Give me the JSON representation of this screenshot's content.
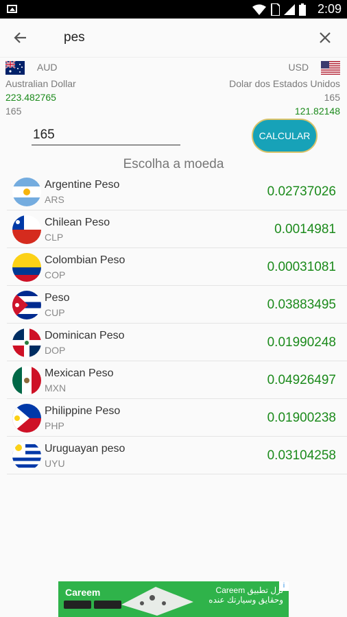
{
  "status": {
    "time": "2:09"
  },
  "search": {
    "query": "pes"
  },
  "conversion": {
    "from": {
      "code": "AUD",
      "name": "Australian Dollar",
      "rate": "223.482765",
      "amount": "165"
    },
    "to": {
      "code": "USD",
      "name": "Dolar dos Estados Unidos",
      "amount": "165",
      "result": "121.82148"
    }
  },
  "input": {
    "value": "165"
  },
  "calc_button": "CALCULAR",
  "choose_label": "Escolha a moeda",
  "currencies": [
    {
      "name": "Argentine Peso",
      "code": "ARS",
      "value": "0.02737026",
      "flag": "argentina-flag"
    },
    {
      "name": "Chilean Peso",
      "code": "CLP",
      "value": "0.0014981",
      "flag": "chile-flag"
    },
    {
      "name": "Colombian Peso",
      "code": "COP",
      "value": "0.00031081",
      "flag": "colombia-flag"
    },
    {
      "name": "Peso",
      "code": "CUP",
      "value": "0.03883495",
      "flag": "cuba-flag"
    },
    {
      "name": "Dominican Peso",
      "code": "DOP",
      "value": "0.01990248",
      "flag": "dominican-flag"
    },
    {
      "name": "Mexican Peso",
      "code": "MXN",
      "value": "0.04926497",
      "flag": "mexico-flag"
    },
    {
      "name": "Philippine Peso",
      "code": "PHP",
      "value": "0.01900238",
      "flag": "philippines-flag"
    },
    {
      "name": "Uruguayan peso",
      "code": "UYU",
      "value": "0.03104258",
      "flag": "uruguay-flag"
    }
  ],
  "ad": {
    "brand": "Careem",
    "line1": "Careem نزل تطبيق",
    "line2": "وحقايق وسيارتك عنده"
  },
  "colors": {
    "accent": "#17a2b8",
    "value_green": "#1b8a1b"
  }
}
